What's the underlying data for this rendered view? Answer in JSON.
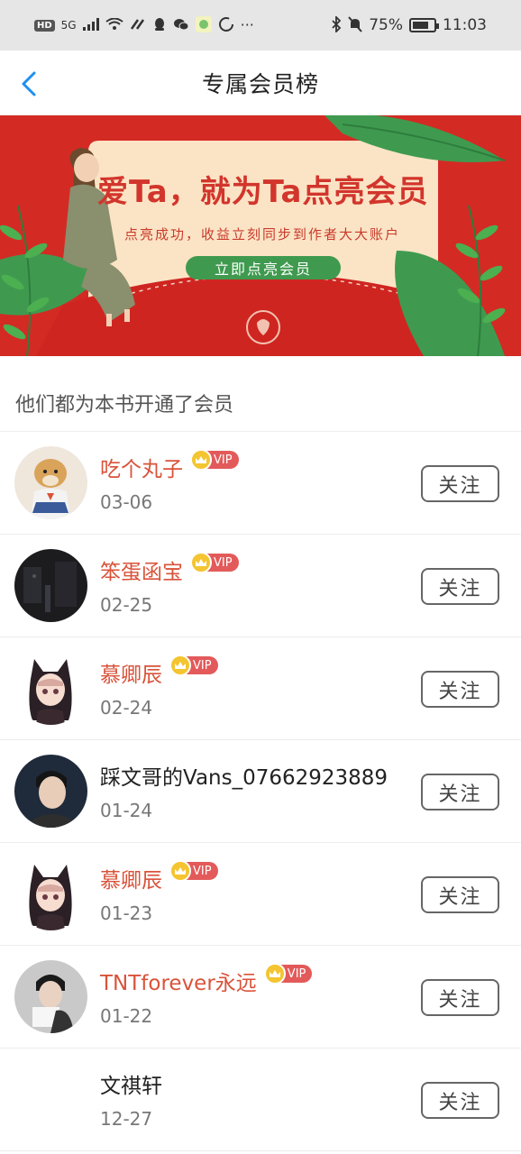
{
  "status_bar": {
    "network_hd": "HD",
    "network_5g": "5G",
    "battery_percent": "75%",
    "battery_level": 0.75,
    "time": "11:03",
    "more": "···"
  },
  "header": {
    "title": "专属会员榜",
    "back_icon": "chevron-left-icon"
  },
  "banner": {
    "title": "爱Ta，就为Ta点亮会员",
    "subtitle": "点亮成功，收益立刻同步到作者大大账户",
    "button_label": "立即点亮会员"
  },
  "section": {
    "title": "他们都为本书开通了会员"
  },
  "colors": {
    "accent_blue": "#1e8ff0",
    "vip_name": "#d9533a",
    "banner_red": "#d42a24",
    "banner_green": "#3f9a4f",
    "vip_badge": "#e35a5a",
    "crown": "#f4c530"
  },
  "vip_label": "VIP",
  "follow_label": "关注",
  "members": [
    {
      "name": "吃个丸子",
      "date": "03-06",
      "vip": true,
      "avatar": "dog-cosplay-avatar"
    },
    {
      "name": "笨蛋函宝",
      "date": "02-25",
      "vip": true,
      "avatar": "dark-scene-avatar"
    },
    {
      "name": "慕卿辰",
      "date": "02-24",
      "vip": true,
      "avatar": "anime-girl-avatar"
    },
    {
      "name": "踩文哥的Vans_07662923889",
      "date": "01-24",
      "vip": false,
      "avatar": "boy-photo-avatar"
    },
    {
      "name": "慕卿辰",
      "date": "01-23",
      "vip": true,
      "avatar": "anime-girl-avatar"
    },
    {
      "name": "TNTforever永远",
      "date": "01-22",
      "vip": true,
      "avatar": "boy-reading-avatar"
    },
    {
      "name": "文祺轩",
      "date": "12-27",
      "vip": false,
      "avatar": "blank-avatar"
    }
  ]
}
